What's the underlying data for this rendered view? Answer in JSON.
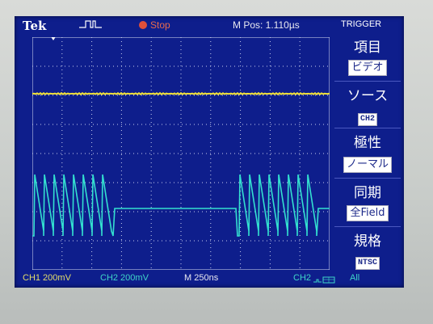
{
  "header": {
    "brand": "Tek",
    "acq_state": "Stop",
    "m_pos": "M Pos: 1.110µs",
    "menu_title": "TRIGGER"
  },
  "side_menu": [
    {
      "head": "項目",
      "value": "ビデオ"
    },
    {
      "head": "ソース",
      "value": "CH2"
    },
    {
      "head": "極性",
      "value": "ノーマル"
    },
    {
      "head": "同期",
      "value": "全Field"
    },
    {
      "head": "規格",
      "value": "NTSC"
    }
  ],
  "channels": {
    "ch1_marker": "1",
    "ch2_marker": "2",
    "ch1_color": "#f2e23a",
    "ch2_color": "#33e0d0"
  },
  "footer": {
    "ch1": "CH1  200mV",
    "ch2": "CH2  200mV",
    "timebase": "M 250ns",
    "trigger_source": "CH2",
    "trigger_mode": "All"
  },
  "icons": {
    "trigger_pulse": "pulse-icon",
    "run": "stop-dot-icon",
    "trigger_position": "trigger-arrow-icon"
  }
}
